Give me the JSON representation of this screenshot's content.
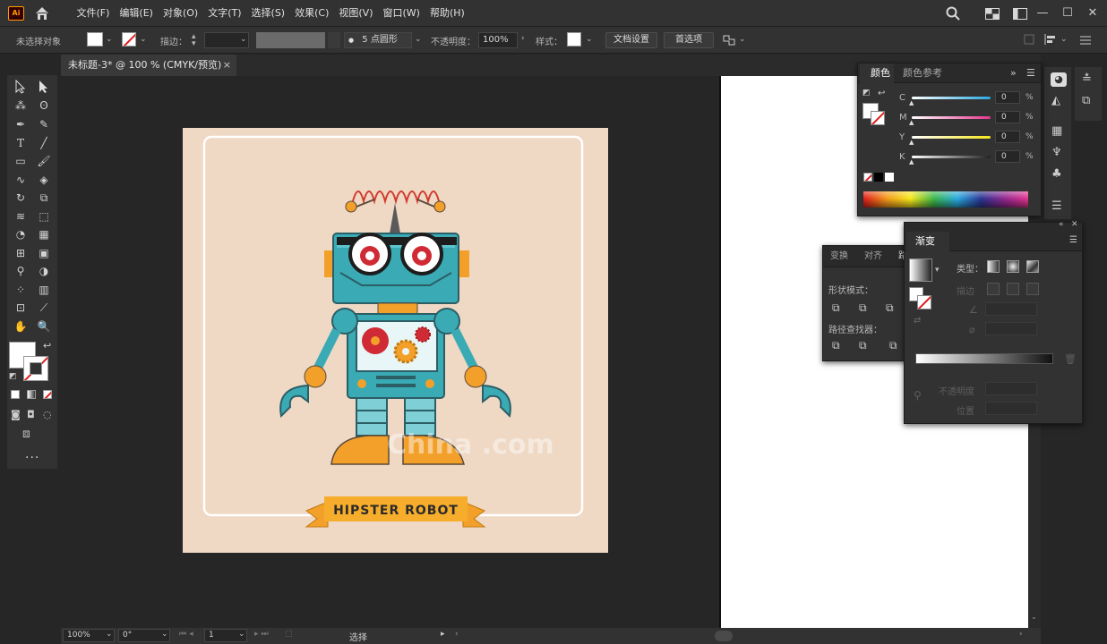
{
  "app": {
    "logo": "Ai",
    "menu": [
      "文件(F)",
      "编辑(E)",
      "对象(O)",
      "文字(T)",
      "选择(S)",
      "效果(C)",
      "视图(V)",
      "窗口(W)",
      "帮助(H)"
    ],
    "window_controls": [
      "—",
      "☐",
      "✕"
    ]
  },
  "control_bar": {
    "selection_status": "未选择对象",
    "stroke_label": "描边：",
    "brush_value": "5 点圆形",
    "opacity_label": "不透明度：",
    "opacity_value": "100%",
    "style_label": "样式：",
    "doc_setup_button": "文档设置",
    "preferences_button": "首选项"
  },
  "document_tab": {
    "title": "未标题-3* @ 100 % (CMYK/预览)",
    "close": "×"
  },
  "artwork": {
    "banner_text": "HIPSTER ROBOT",
    "watermark": "China .com"
  },
  "status_bar": {
    "zoom": "100%",
    "rotation": "0°",
    "artboard_number": "1",
    "tool_name": "选择"
  },
  "color_panel": {
    "tabs": [
      "颜色",
      "颜色参考"
    ],
    "channels": [
      {
        "label": "C",
        "value": "0",
        "color": "#29a9e1"
      },
      {
        "label": "M",
        "value": "0",
        "color": "#e4358f"
      },
      {
        "label": "Y",
        "value": "0",
        "color": "#f6e71a"
      },
      {
        "label": "K",
        "value": "0",
        "color": "#7a7a7a"
      }
    ],
    "percent": "%"
  },
  "transform_panel": {
    "tabs": [
      "变换",
      "对齐",
      "路"
    ],
    "shape_modes_label": "形状模式：",
    "pathfinder_label": "路径查找器："
  },
  "gradient_panel": {
    "title": "渐变",
    "type_label": "类型：",
    "stroke_label": "描边",
    "opacity_label": "不透明度",
    "position_label": "位置"
  }
}
